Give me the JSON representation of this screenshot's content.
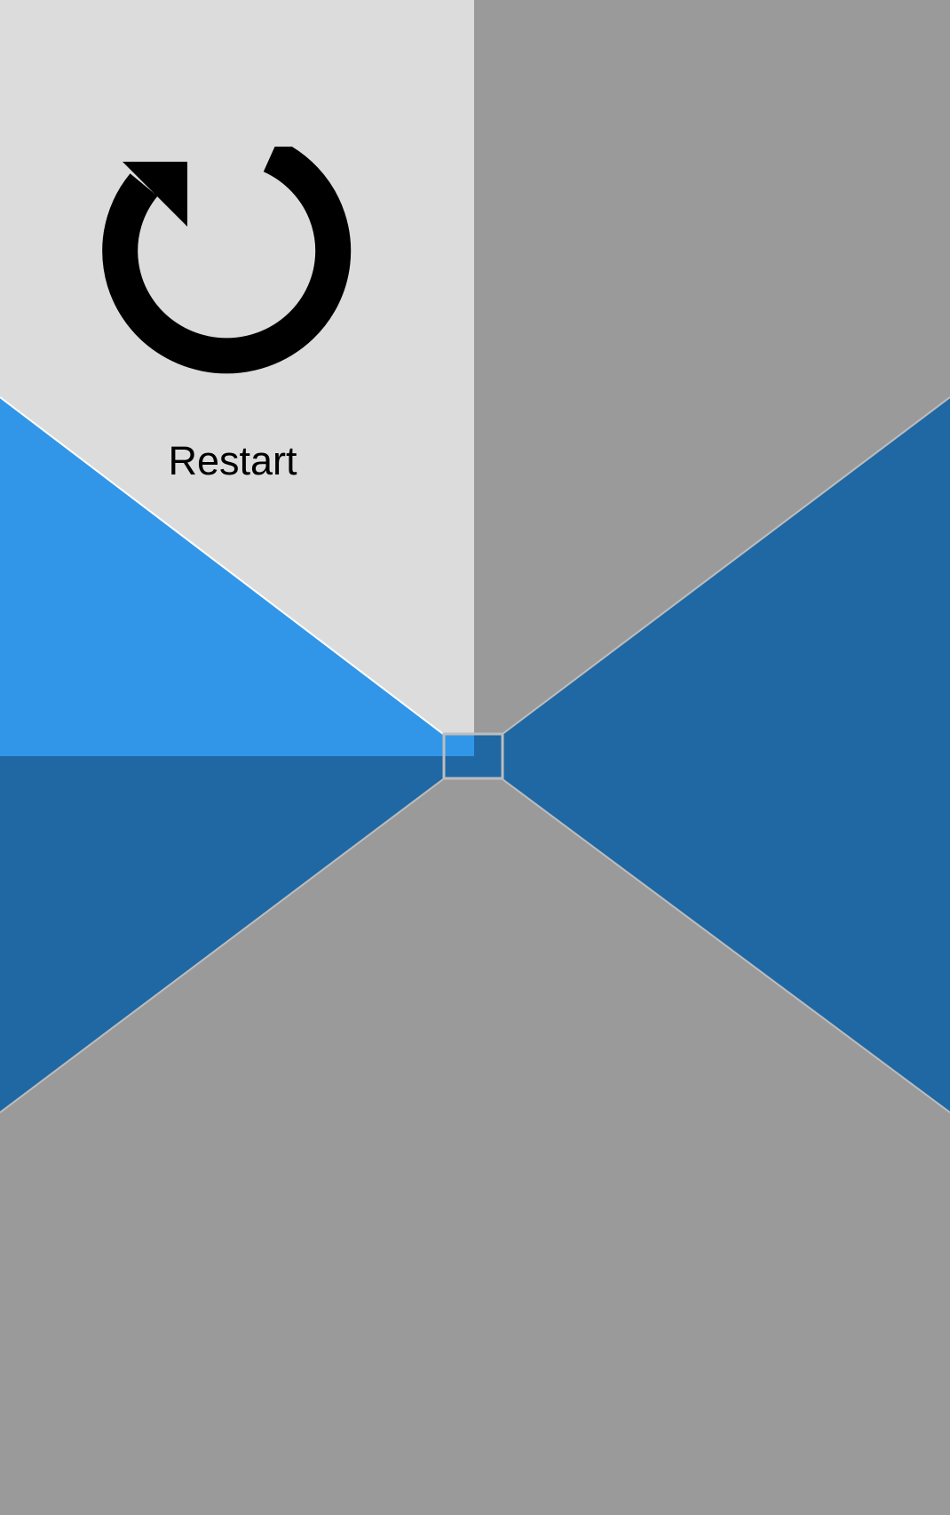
{
  "colors": {
    "background": "#9a9a9a",
    "restart_panel": "#dcdcdc",
    "light_blue": "#3296e8",
    "dark_blue": "#1f68a4",
    "edge_light": "#ffffff",
    "edge_dark": "#bdbdbd"
  },
  "restart": {
    "label": "Restart",
    "icon": "restart-icon"
  }
}
